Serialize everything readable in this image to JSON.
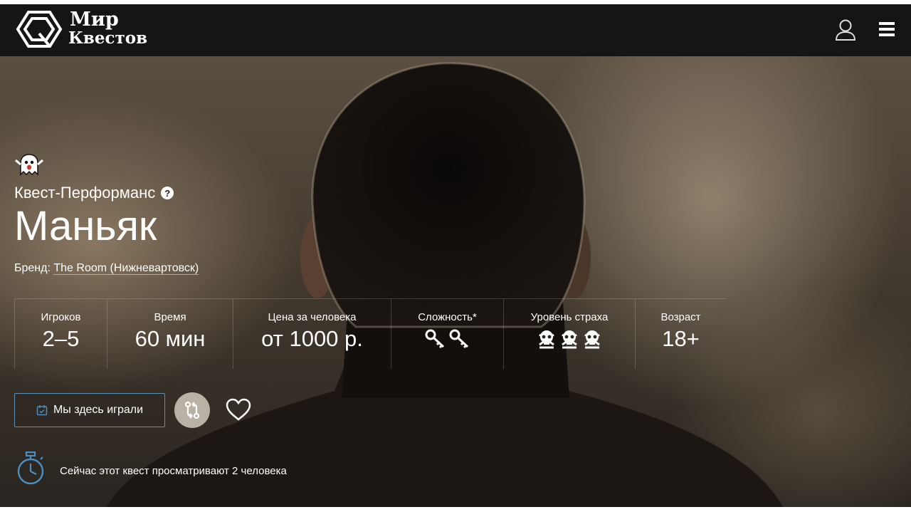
{
  "header": {
    "logo_line1": "Мир",
    "logo_line2": "Квестов",
    "user_icon": "user-icon",
    "menu_icon": "hamburger-menu-icon"
  },
  "quest": {
    "type": "Квест-Перформанс",
    "title": "Маньяк",
    "brand_label": "Бренд:",
    "brand_name": "The Room (Нижневартовск)"
  },
  "stats": [
    {
      "label": "Игроков",
      "value": "2–5"
    },
    {
      "label": "Время",
      "value": "60 мин"
    },
    {
      "label": "Цена за человека",
      "value": "от 1000 р."
    },
    {
      "label": "Сложность*",
      "icon": "key-icon",
      "count": 2
    },
    {
      "label": "Уровень страха",
      "icon": "skull-icon",
      "count": 3
    },
    {
      "label": "Возраст",
      "value": "18+"
    }
  ],
  "actions": {
    "played_label": "Мы здесь играли",
    "compare_icon": "compare-icon",
    "favorite_icon": "heart-icon"
  },
  "viewers_text": "Сейчас этот квест просматривают 2 человека",
  "colors": {
    "header_bg": "#151515",
    "button_border": "#5f8fb0",
    "compare_bg": "#b9b1a4",
    "accent_icon": "#4d8fc0"
  }
}
